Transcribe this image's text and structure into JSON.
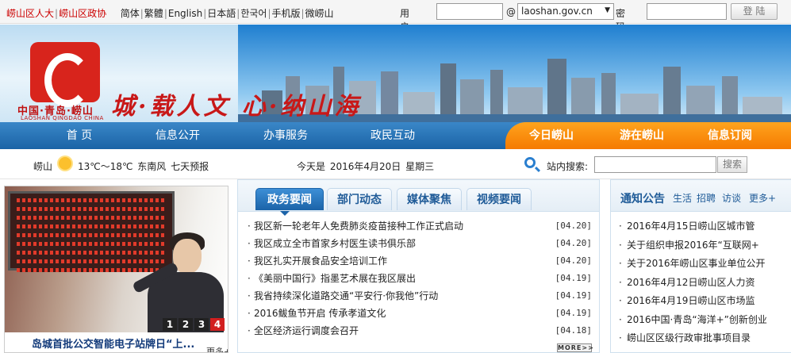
{
  "topbar": {
    "links": [
      "崂山区人大",
      "崂山区政协",
      "简体",
      "繁體",
      "English",
      "日本語",
      "한국어",
      "手机版",
      "微崂山"
    ],
    "login": {
      "username_label": "用户名:",
      "at": "@",
      "domain": "laoshan.gov.cn",
      "password_label": "密码:",
      "login_button": "登 陆"
    }
  },
  "banner": {
    "city_name": "中国·青岛·崂山",
    "city_en": "LAOSHAN QINGDAO CHINA",
    "slogan": "城·载人文 心·纳山海"
  },
  "nav": {
    "items": [
      "首 页",
      "信息公开",
      "办事服务",
      "政民互动",
      "今日崂山",
      "游在崂山",
      "信息订阅"
    ]
  },
  "infobar": {
    "city": "崂山",
    "weather": "13℃～18℃  东南风  七天预报",
    "date": "今天是  2016年4月20日  星期三",
    "search_label": "站内搜索:",
    "search_button": "搜索"
  },
  "photo": {
    "caption": "岛城首批公交智能电子站牌日“上...",
    "more": "更多+",
    "pages": [
      "1",
      "2",
      "3",
      "4"
    ],
    "active_page": "4"
  },
  "news": {
    "tabs": [
      "政务要闻",
      "部门动态",
      "媒体聚焦",
      "视频要闻"
    ],
    "items": [
      {
        "title": "我区新一轮老年人免费肺炎疫苗接种工作正式启动",
        "date": "[04.20]"
      },
      {
        "title": "我区成立全市首家乡村医生读书俱乐部",
        "date": "[04.20]"
      },
      {
        "title": "我区扎实开展食品安全培训工作",
        "date": "[04.20]"
      },
      {
        "title": "《美丽中国行》指墨艺术展在我区展出",
        "date": "[04.19]"
      },
      {
        "title": "我省持续深化道路交通“平安行·你我他”行动",
        "date": "[04.19]"
      },
      {
        "title": "2016鲅鱼节开启 传承孝道文化",
        "date": "[04.19]"
      },
      {
        "title": "全区经济运行调度会召开",
        "date": "[04.18]"
      }
    ],
    "more_button": "MORE>>"
  },
  "notice": {
    "title": "通知公告",
    "subtabs": [
      "生活",
      "招聘",
      "访谈"
    ],
    "more": "更多+",
    "items": [
      "2016年4月15日崂山区城市管",
      "关于组织申报2016年“互联网+",
      "关于2016年崂山区事业单位公开",
      "2016年4月12日崂山区人力资",
      "2016年4月19日崂山区市场监",
      "2016中国·青岛“海洋+”创新创业",
      "崂山区区级行政审批事项目录"
    ]
  }
}
